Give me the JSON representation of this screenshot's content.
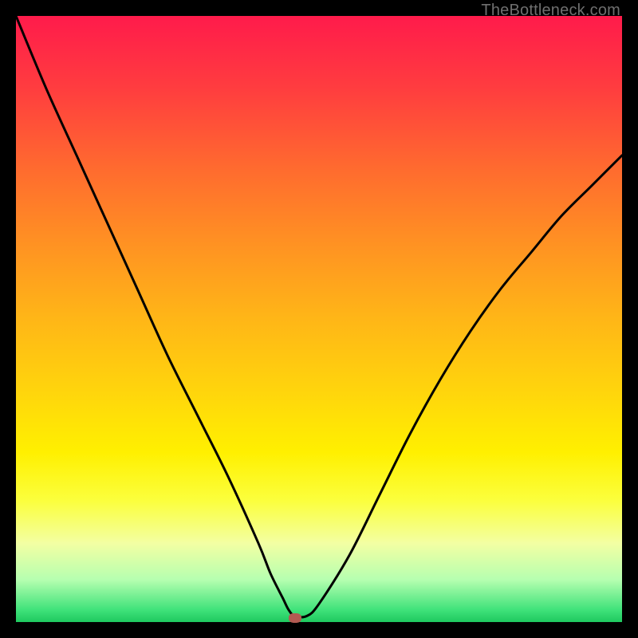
{
  "watermark": "TheBottleneck.com",
  "colors": {
    "frame": "#000000",
    "gradient_top": "#ff1b4b",
    "gradient_bottom": "#1fc95f",
    "curve": "#000000",
    "marker": "#b35a52"
  },
  "chart_data": {
    "type": "line",
    "title": "",
    "xlabel": "",
    "ylabel": "",
    "xlim": [
      0,
      100
    ],
    "ylim": [
      0,
      100
    ],
    "grid": false,
    "legend": false,
    "annotations": [],
    "series": [
      {
        "name": "curve",
        "x": [
          0,
          5,
          10,
          15,
          20,
          25,
          30,
          35,
          40,
          42,
          44,
          45,
          46,
          48,
          50,
          55,
          60,
          65,
          70,
          75,
          80,
          85,
          90,
          95,
          100
        ],
        "y": [
          100,
          88,
          77,
          66,
          55,
          44,
          34,
          24,
          13,
          8,
          4,
          2,
          1,
          1,
          3,
          11,
          21,
          31,
          40,
          48,
          55,
          61,
          67,
          72,
          77
        ]
      }
    ],
    "marker": {
      "x": 46,
      "y_baseline": 0
    }
  }
}
